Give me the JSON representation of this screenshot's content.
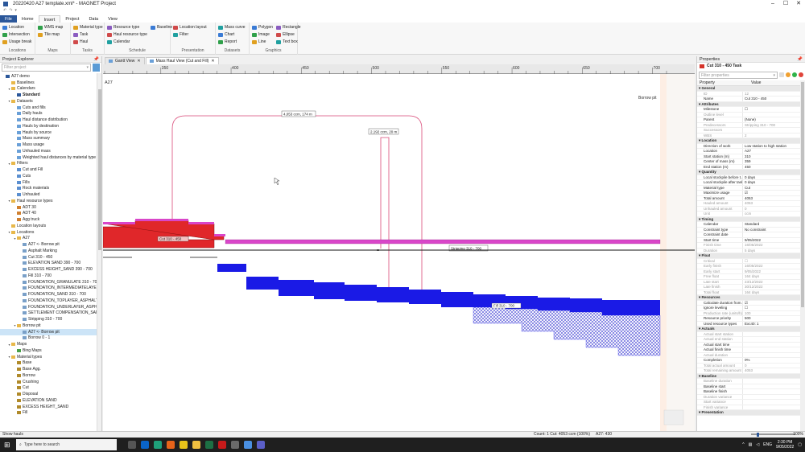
{
  "title_bar": {
    "title": "20220420 A27 template.xml* - MAGNET Project",
    "window_controls": [
      "minimize-icon",
      "maximize-icon",
      "close-icon"
    ]
  },
  "menu": {
    "tabs": [
      {
        "label": "File"
      },
      {
        "label": "Home"
      },
      {
        "label": "Insert"
      },
      {
        "label": "Project"
      },
      {
        "label": "Data"
      },
      {
        "label": "View"
      }
    ],
    "active": "Insert"
  },
  "ribbon": {
    "groups": [
      {
        "name": "Locations",
        "items": [
          "Location",
          "Intersection",
          "Usage break"
        ]
      },
      {
        "name": "Maps",
        "items": [
          "WMS map",
          "Tile map"
        ]
      },
      {
        "name": "Tasks",
        "items": [
          "Material type",
          "Task",
          "Haul"
        ]
      },
      {
        "name": "Schedule",
        "items": [
          "Resource type",
          "Haul resource type",
          "Calendar",
          "Baseline"
        ]
      },
      {
        "name": "Presentation",
        "items": [
          "Location layout",
          "Filter"
        ]
      },
      {
        "name": "Datasets",
        "items": [
          "Mass curve",
          "Chart",
          "Report"
        ]
      },
      {
        "name": "Graphics",
        "items": [
          "Polygon",
          "Image",
          "Line",
          "Rectangle",
          "Ellipse",
          "Text box"
        ]
      }
    ]
  },
  "explorer": {
    "title": "Project Explorer",
    "search_placeholder": "Filter project",
    "tree": [
      {
        "label": "A27 demo",
        "level": 0,
        "icon": "project-icon"
      },
      {
        "label": "Baselines",
        "level": 1,
        "icon": "folder-icon"
      },
      {
        "label": "Calendars",
        "level": 1,
        "icon": "folder-icon",
        "expanded": true
      },
      {
        "label": "Standard",
        "level": 2,
        "icon": "calendar-icon",
        "bold": true
      },
      {
        "label": "Datasets",
        "level": 1,
        "icon": "folder-icon",
        "expanded": true
      },
      {
        "label": "Cuts and fills",
        "level": 2,
        "icon": "dataset-icon"
      },
      {
        "label": "Daily hauls",
        "level": 2,
        "icon": "dataset-icon"
      },
      {
        "label": "Haul distance distribution",
        "level": 2,
        "icon": "dataset-icon"
      },
      {
        "label": "Hauls by destination",
        "level": 2,
        "icon": "dataset-icon"
      },
      {
        "label": "Hauls by source",
        "level": 2,
        "icon": "dataset-icon"
      },
      {
        "label": "Mass summary",
        "level": 2,
        "icon": "dataset-icon"
      },
      {
        "label": "Mass usage",
        "level": 2,
        "icon": "dataset-icon"
      },
      {
        "label": "Unhauled mass",
        "level": 2,
        "icon": "dataset-icon"
      },
      {
        "label": "Weighted haul distances by material type",
        "level": 2,
        "icon": "dataset-icon"
      },
      {
        "label": "Filters",
        "level": 1,
        "icon": "folder-icon",
        "expanded": true
      },
      {
        "label": "Cut and Fill",
        "level": 2,
        "icon": "filter-icon"
      },
      {
        "label": "Cuts",
        "level": 2,
        "icon": "filter-icon"
      },
      {
        "label": "Fills",
        "level": 2,
        "icon": "filter-icon"
      },
      {
        "label": "Rock materials",
        "level": 2,
        "icon": "filter-icon"
      },
      {
        "label": "Unhauled",
        "level": 2,
        "icon": "filter-icon"
      },
      {
        "label": "Haul resource types",
        "level": 1,
        "icon": "folder-icon",
        "expanded": true
      },
      {
        "label": "ADT 30",
        "level": 2,
        "icon": "truck-icon"
      },
      {
        "label": "ADT 40",
        "level": 2,
        "icon": "truck-icon"
      },
      {
        "label": "Agg truck",
        "level": 2,
        "icon": "truck-icon"
      },
      {
        "label": "Location layouts",
        "level": 1,
        "icon": "folder-icon"
      },
      {
        "label": "Locations",
        "level": 1,
        "icon": "folder-icon",
        "expanded": true
      },
      {
        "label": "A27",
        "level": 2,
        "icon": "folder-icon",
        "expanded": true
      },
      {
        "label": "A27 <- Borrow pit",
        "level": 3,
        "icon": "task-icon"
      },
      {
        "label": "Asphalt Marking",
        "level": 3,
        "icon": "task-icon"
      },
      {
        "label": "Cut 310 - 450",
        "level": 3,
        "icon": "task-icon"
      },
      {
        "label": "ELEVATION SAND 390 - 700",
        "level": 3,
        "icon": "task-icon"
      },
      {
        "label": "EXCESS HEIGHT_SAND 390 - 700",
        "level": 3,
        "icon": "task-icon"
      },
      {
        "label": "Fill 310 - 700",
        "level": 3,
        "icon": "task-icon"
      },
      {
        "label": "FOUNDATION_GRANULATE 310 - 700",
        "level": 3,
        "icon": "task-icon"
      },
      {
        "label": "FOUNDATION_INTERMEDIATELAYER_AS",
        "level": 3,
        "icon": "task-icon"
      },
      {
        "label": "FOUNDATION_SAND 310 - 700",
        "level": 3,
        "icon": "task-icon"
      },
      {
        "label": "FOUNDATION_TOPLAYER_ASPHALT 310",
        "level": 3,
        "icon": "task-icon"
      },
      {
        "label": "FOUNDATION_UNDERLAYER_ASPHALT",
        "level": 3,
        "icon": "task-icon"
      },
      {
        "label": "SETTLEMENT COMPENSATION_SAND 3",
        "level": 3,
        "icon": "task-icon"
      },
      {
        "label": "Stripping 310 - 700",
        "level": 3,
        "icon": "task-icon"
      },
      {
        "label": "Borrow pit",
        "level": 2,
        "icon": "folder-icon",
        "expanded": true
      },
      {
        "label": "A27 <- Borrow pit",
        "level": 3,
        "icon": "task-icon",
        "selected": true
      },
      {
        "label": "Borrow 0 - 1",
        "level": 3,
        "icon": "task-icon"
      },
      {
        "label": "Maps",
        "level": 1,
        "icon": "folder-icon",
        "expanded": true
      },
      {
        "label": "Bing Maps",
        "level": 2,
        "icon": "map-icon"
      },
      {
        "label": "Material types",
        "level": 1,
        "icon": "folder-icon",
        "expanded": true
      },
      {
        "label": "Base",
        "level": 2,
        "icon": "material-icon"
      },
      {
        "label": "Base Agg.",
        "level": 2,
        "icon": "material-icon"
      },
      {
        "label": "Borrow",
        "level": 2,
        "icon": "material-icon"
      },
      {
        "label": "Crushing",
        "level": 2,
        "icon": "material-icon"
      },
      {
        "label": "Cut",
        "level": 2,
        "icon": "material-icon"
      },
      {
        "label": "Disposal",
        "level": 2,
        "icon": "material-icon"
      },
      {
        "label": "ELEVATION SAND",
        "level": 2,
        "icon": "material-icon"
      },
      {
        "label": "EXCESS HEIGHT_SAND",
        "level": 2,
        "icon": "material-icon"
      },
      {
        "label": "Fill",
        "level": 2,
        "icon": "material-icon"
      }
    ]
  },
  "document": {
    "tabs": [
      {
        "label": "Gantt View",
        "active": false
      },
      {
        "label": "Mass Haul View (Cut and Fill)",
        "active": true
      }
    ],
    "ruler_labels": [
      "350",
      "400",
      "450",
      "500",
      "550",
      "600",
      "650",
      "700"
    ],
    "view": {
      "location_label": "A27",
      "borrow_label": "Borrow pit",
      "haul_labels": [
        "4,053 ccm, 174 m",
        "2,192 ccm, 20 m"
      ],
      "cut_label": "Cut 310 - 450",
      "stripping_label": "Stripping 310 - 700",
      "fill_label": "Fill 310 - 700"
    }
  },
  "properties": {
    "title": "Properties",
    "subtitle": "Cut 310 - 450 Task",
    "search_placeholder": "Filter properties",
    "header": {
      "property": "Property",
      "value": "Value"
    },
    "rows": [
      {
        "cat": "General"
      },
      {
        "n": "ID",
        "v": "12",
        "dim": true
      },
      {
        "n": "Name",
        "v": "Cut 310 - 450"
      },
      {
        "cat": "Attributes"
      },
      {
        "n": "Milestone",
        "v": "☐"
      },
      {
        "n": "Outline level",
        "v": "",
        "dim": true
      },
      {
        "n": "Parent",
        "v": "(None)"
      },
      {
        "n": "Predecessors",
        "v": "Stripping 310 - 700",
        "dim": true
      },
      {
        "n": "Successors",
        "v": "",
        "dim": true
      },
      {
        "n": "WBS",
        "v": "2",
        "dim": true
      },
      {
        "cat": "Location"
      },
      {
        "n": "Direction of work",
        "v": "Low station to high station"
      },
      {
        "n": "Location",
        "v": "A27"
      },
      {
        "n": "Start station (m)",
        "v": "310"
      },
      {
        "n": "Center of mass (m)",
        "v": "359"
      },
      {
        "n": "End station (m)",
        "v": "450"
      },
      {
        "cat": "Quantity"
      },
      {
        "n": "Local stockpile before t...",
        "v": "0 days"
      },
      {
        "n": "Local stockpile after task",
        "v": "0 days"
      },
      {
        "n": "Material type",
        "v": "Cut"
      },
      {
        "n": "Maximize usage",
        "v": "☑"
      },
      {
        "n": "Total amount",
        "v": "4053"
      },
      {
        "n": "Hauled amount",
        "v": "4053",
        "dim": true
      },
      {
        "n": "Unhauled amount",
        "v": "0",
        "dim": true
      },
      {
        "n": "Unit",
        "v": "ccm",
        "dim": true
      },
      {
        "cat": "Timing"
      },
      {
        "n": "Calendar",
        "v": "Standard"
      },
      {
        "n": "Constraint type",
        "v": "No constraint"
      },
      {
        "n": "Constraint date",
        "v": ""
      },
      {
        "n": "Start time",
        "v": "9/05/2022"
      },
      {
        "n": "Finish time",
        "v": "16/05/2022",
        "dim": true
      },
      {
        "n": "Duration",
        "v": "5 days",
        "dim": true
      },
      {
        "cat": "Float"
      },
      {
        "n": "Critical",
        "v": "☐",
        "dim": true
      },
      {
        "n": "Early finish",
        "v": "16/05/2022",
        "dim": true
      },
      {
        "n": "Early start",
        "v": "9/05/2022",
        "dim": true
      },
      {
        "n": "Free float",
        "v": "164 days",
        "dim": true
      },
      {
        "n": "Late start",
        "v": "23/12/2022",
        "dim": true
      },
      {
        "n": "Late finish",
        "v": "30/12/2022",
        "dim": true
      },
      {
        "n": "Total float",
        "v": "164 days",
        "dim": true
      },
      {
        "cat": "Resources"
      },
      {
        "n": "Calculate duration from...",
        "v": "☑"
      },
      {
        "n": "Ignore leveling",
        "v": "☐"
      },
      {
        "n": "Production rate (units/h)",
        "v": "100",
        "dim": true
      },
      {
        "n": "Resource priority",
        "v": "500"
      },
      {
        "n": "Used resource types",
        "v": "Exc40: 1"
      },
      {
        "cat": "Actuals"
      },
      {
        "n": "Actual start station",
        "v": "",
        "dim": true
      },
      {
        "n": "Actual end station",
        "v": "",
        "dim": true
      },
      {
        "n": "Actual start time",
        "v": ""
      },
      {
        "n": "Actual finish time",
        "v": ""
      },
      {
        "n": "Actual duration",
        "v": "",
        "dim": true
      },
      {
        "n": "Completion",
        "v": "0%"
      },
      {
        "n": "Total actual amount",
        "v": "0",
        "dim": true
      },
      {
        "n": "Total remaining amount",
        "v": "4053",
        "dim": true
      },
      {
        "cat": "Baseline"
      },
      {
        "n": "Baseline duration",
        "v": "",
        "dim": true
      },
      {
        "n": "Baseline start",
        "v": ""
      },
      {
        "n": "Baseline finish",
        "v": ""
      },
      {
        "n": "Duration variance",
        "v": "",
        "dim": true
      },
      {
        "n": "Start variance",
        "v": "",
        "dim": true
      },
      {
        "n": "Finish variance",
        "v": "",
        "dim": true
      },
      {
        "cat": "Presentation"
      }
    ]
  },
  "status": {
    "left": "Show hauls",
    "right": "Count: 1 Cut: 4053 ccm (100%)",
    "location": "A27: 430",
    "zoom": "100%"
  },
  "taskbar": {
    "search_placeholder": "Type here to search",
    "language": "ENG",
    "time": "2:30 PM",
    "date": "9/05/2022"
  },
  "colors": {
    "accent": "#2b579a",
    "cut_red": "#e0272a",
    "stripping_magenta": "#d946c9",
    "fill_blue": "#1a1ae6",
    "haul_line": "#d94a78"
  }
}
